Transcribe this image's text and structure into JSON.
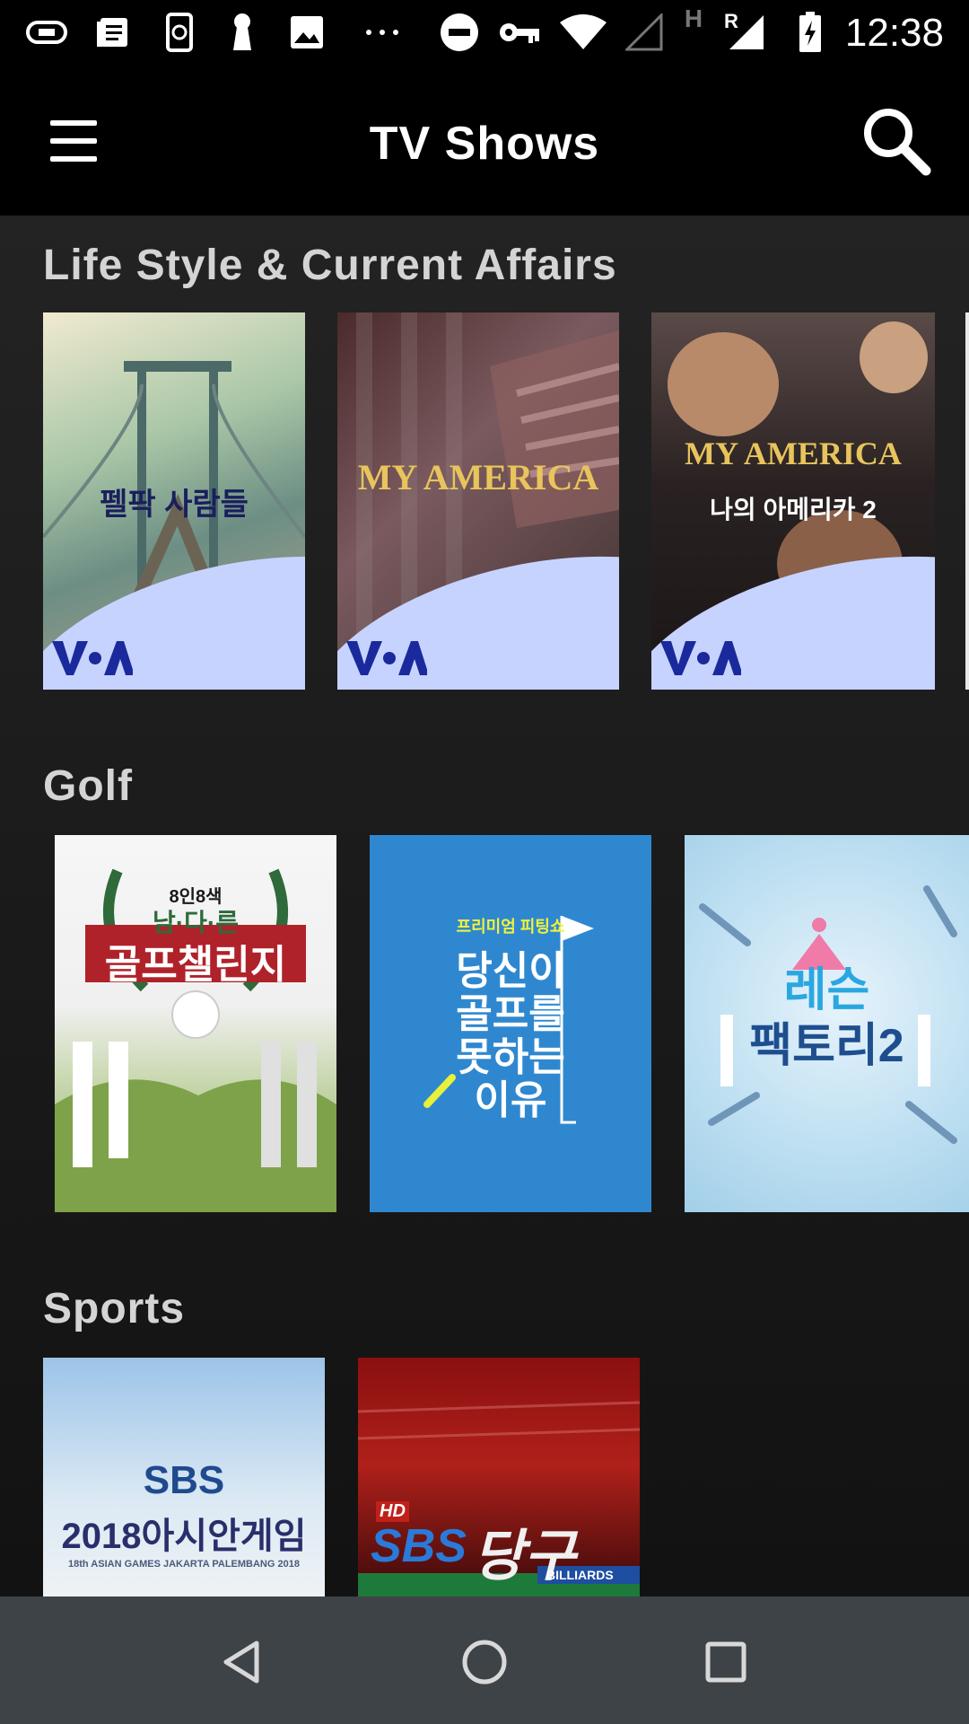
{
  "status_bar": {
    "time": "12:38",
    "icons": [
      "usb-icon",
      "notes-icon",
      "phone-sync-icon",
      "keyhole-icon",
      "image-icon",
      "more-dots-icon",
      "do-not-disturb-icon",
      "key-icon",
      "wifi-icon",
      "signal-empty-icon",
      "h-label",
      "signal-roaming-icon",
      "battery-charging-icon"
    ],
    "network_letters": [
      "H",
      "R"
    ]
  },
  "app_bar": {
    "title": "TV Shows",
    "menu_icon": "hamburger-menu-icon",
    "search_icon": "search-icon"
  },
  "sections": [
    {
      "title": "Life Style & Current Affairs",
      "items": [
        {
          "name": "펠팍 사람들",
          "logo": "VOA"
        },
        {
          "name": "MY AMERICA",
          "logo": "VOA"
        },
        {
          "name": "MY AMERICA",
          "subtitle": "나의 아메리카 2",
          "logo": "VOA"
        }
      ]
    },
    {
      "title": "Golf",
      "items": [
        {
          "badge": "8인8색",
          "top": "남·다·른",
          "name": "골프챌린지"
        },
        {
          "badge": "프리미엄 피팅쇼",
          "name_lines": [
            "당신이",
            "골프를",
            "못하는",
            "이유"
          ]
        },
        {
          "line1": "레슨",
          "name": "팩토리2"
        }
      ]
    },
    {
      "title": "Sports",
      "items": [
        {
          "brand": "SBS",
          "name": "2018아시안게임",
          "caption": "18th ASIAN GAMES JAKARTA PALEMBANG 2018"
        },
        {
          "hd": "HD",
          "brand": "SBS",
          "name": "당구",
          "caption": "BILLIARDS"
        }
      ]
    }
  ],
  "colors": {
    "background": "#141414",
    "app_bar": "#000000",
    "nav_bar": "#3e4347",
    "section_title": "#d4d4d4",
    "voa_blue": "#1a2a9c"
  }
}
